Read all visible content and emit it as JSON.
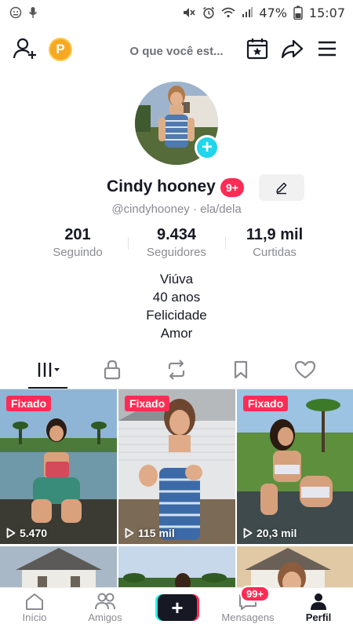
{
  "status_bar": {
    "battery": "47%",
    "time": "15:07",
    "left_icons": [
      "face-icon",
      "mic-icon"
    ],
    "right_icons": [
      "mute-icon",
      "alarm-icon",
      "wifi-icon",
      "signal-icon"
    ]
  },
  "top_bar": {
    "coin_label": "P",
    "thought_text": "O que você est..."
  },
  "profile": {
    "name": "Cindy hooney",
    "badge": "9+",
    "handle": "@cindyhooney · ela/dela"
  },
  "stats": [
    {
      "value": "201",
      "label": "Seguindo"
    },
    {
      "value": "9.434",
      "label": "Seguidores"
    },
    {
      "value": "11,9 mil",
      "label": "Curtidas"
    }
  ],
  "bio": [
    "Viúva",
    "40 anos",
    "Felicidade",
    "Amor"
  ],
  "tabs": [
    "videos-grid-icon",
    "lock-icon",
    "repost-icon",
    "bookmark-icon",
    "heart-icon"
  ],
  "videos": [
    {
      "pinned": "Fixado",
      "views": "5.470"
    },
    {
      "pinned": "Fixado",
      "views": "115 mil"
    },
    {
      "pinned": "Fixado",
      "views": "20,3 mil"
    }
  ],
  "bottom_nav": {
    "home": "Início",
    "friends": "Amigos",
    "messages": "Mensagens",
    "messages_badge": "99+",
    "profile": "Perfil"
  },
  "colors": {
    "accent": "#fe2c55",
    "cyan": "#20d5ec",
    "coin": "#f7a823"
  }
}
